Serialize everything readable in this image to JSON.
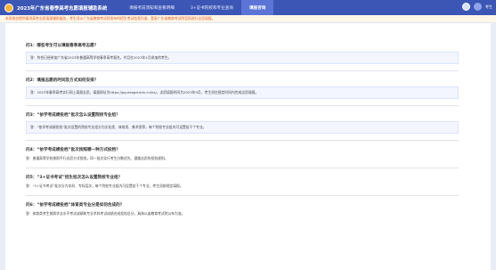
{
  "header": {
    "title": "2023年广东省春季高考志愿填报辅助系统",
    "nav": [
      "填报考前须知和查看明细",
      "3+证书院校和专业查询",
      "填报咨询"
    ],
    "active_nav": 2,
    "user": "考生"
  },
  "notice": "本系统仅提供春季高考志愿填报辅助服务，考生须以广东省教育考试院发布的招生考试信息为准，登录广东省教育考试院官网进行志愿填报。",
  "faq": [
    {
      "q": "问1：哪些考生可以填报春季高考志愿？",
      "a": "答：符合已经参加广东省2023年普通高等学校春季高考报名，并且在2023年1月参加的考生。",
      "h": true
    },
    {
      "q": "问2：填报志愿的时间及方式如何安排？",
      "a": "答：2023年春季高考实行网上填报志愿，填报网址为https://pg.eeagd.edu.cn/ks/。志愿填报时间为2023年5月，考生须在规定时间内完成志愿填报。",
      "h": true
    },
    {
      "q": "问3：“依学考成绩投档”批次怎么设置院校专业组？",
      "a": "答：“依学考成绩投档”批次设置的院校专业组分为文化类、体育类、美术类等，每个院校专业组内可设置若干个专业。",
      "h": true
    },
    {
      "q": "问4：“依学考成绩投档”批次按照哪一种方式投档？",
      "a": "答：普通高等学校按照平行志愿方式投档，同一批次实行考生分数优先、遵循志愿的投档规则。",
      "h": false
    },
    {
      "q": "问5：“3+证书考试”招生批次怎么设置院校专业组？",
      "a": "答：“3+证书考试”批次分为本科、专科层次，每个院校专业组内可设置若干个专业，考生须按规定填报。",
      "h": false
    },
    {
      "q": "问6：“依学考成绩投档”体育类专业分是如何合成的？",
      "a": "答：体育类考生按照学业水平考试成绩和专业术科考试成绩合成投档总分，具体以省教育考试院公布为准。",
      "h": false
    }
  ]
}
